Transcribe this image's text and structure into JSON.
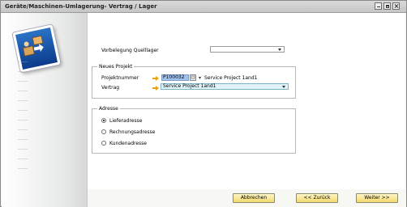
{
  "window": {
    "title": "Geräte/Maschinen-Umlagerung- Vertrag / Lager"
  },
  "form": {
    "vorbelegung_label": "Vorbelegung Quelllager",
    "vorbelegung_value": "",
    "neues_projekt": {
      "legend": "Neues Projekt",
      "projektnummer_label": "Projektnummer",
      "projektnummer_value": "P100032",
      "projekt_name": "Service Project 1and1",
      "vertrag_label": "Vertrag",
      "vertrag_value": "Service Project 1and1"
    },
    "adresse": {
      "legend": "Adresse",
      "options": [
        "Lieferadresse",
        "Rechnungsadresse",
        "Kundenadresse"
      ],
      "selected": "Lieferadresse"
    }
  },
  "buttons": {
    "cancel": "Abbrechen",
    "back": "<< Zurück",
    "next": "Weiter >>"
  },
  "colors": {
    "button_fill": "#f2d96a",
    "highlight_field": "#dff3f8",
    "link_arrow": "#e3a316"
  }
}
